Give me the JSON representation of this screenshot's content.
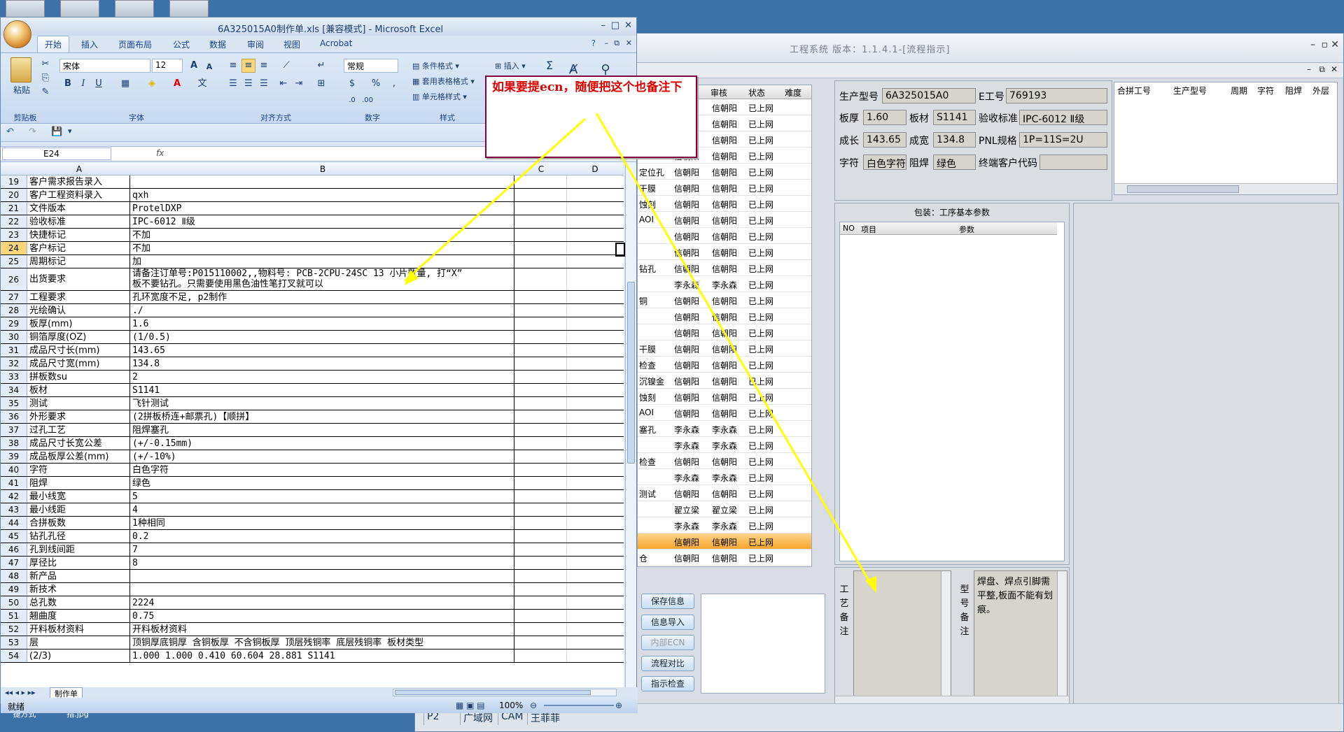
{
  "desktop": {
    "bottom_icons": [
      "FastMsg - 快捷方式",
      "正常金手指.jpg"
    ]
  },
  "app": {
    "title": "工程系统 版本：1.1.4.1-[流程指示]",
    "grid": {
      "headers": [
        "审核",
        "状态",
        "难度"
      ],
      "rows": [
        {
          "a": "",
          "b": "信朝阳",
          "c": "信朝阳",
          "s": "已上网"
        },
        {
          "a": "",
          "b": "信朝阳",
          "c": "信朝阳",
          "s": "已上网"
        },
        {
          "a": "",
          "b": "信朝阳",
          "c": "信朝阳",
          "s": "已上网"
        },
        {
          "a": "",
          "b": "信朝阳",
          "c": "信朝阳",
          "s": "已上网"
        },
        {
          "a": "定位孔",
          "b": "信朝阳",
          "c": "信朝阳",
          "s": "已上网"
        },
        {
          "a": "干膜",
          "b": "信朝阳",
          "c": "信朝阳",
          "s": "已上网"
        },
        {
          "a": "蚀刻",
          "b": "信朝阳",
          "c": "信朝阳",
          "s": "已上网"
        },
        {
          "a": "AOI",
          "b": "信朝阳",
          "c": "信朝阳",
          "s": "已上网"
        },
        {
          "a": "",
          "b": "信朝阳",
          "c": "信朝阳",
          "s": "已上网"
        },
        {
          "a": "",
          "b": "信朝阳",
          "c": "信朝阳",
          "s": "已上网"
        },
        {
          "a": "钻孔",
          "b": "信朝阳",
          "c": "信朝阳",
          "s": "已上网"
        },
        {
          "a": "",
          "b": "李永森",
          "c": "李永森",
          "s": "已上网"
        },
        {
          "a": "铜",
          "b": "信朝阳",
          "c": "信朝阳",
          "s": "已上网"
        },
        {
          "a": "",
          "b": "信朝阳",
          "c": "信朝阳",
          "s": "已上网"
        },
        {
          "a": "",
          "b": "信朝阳",
          "c": "信朝阳",
          "s": "已上网"
        },
        {
          "a": "干膜",
          "b": "信朝阳",
          "c": "信朝阳",
          "s": "已上网"
        },
        {
          "a": "检查",
          "b": "信朝阳",
          "c": "信朝阳",
          "s": "已上网"
        },
        {
          "a": "沉镍金",
          "b": "信朝阳",
          "c": "信朝阳",
          "s": "已上网"
        },
        {
          "a": "蚀刻",
          "b": "信朝阳",
          "c": "信朝阳",
          "s": "已上网"
        },
        {
          "a": "AOI",
          "b": "信朝阳",
          "c": "信朝阳",
          "s": "已上网"
        },
        {
          "a": "塞孔",
          "b": "李永森",
          "c": "李永森",
          "s": "已上网"
        },
        {
          "a": "",
          "b": "李永森",
          "c": "李永森",
          "s": "已上网"
        },
        {
          "a": "检查",
          "b": "信朝阳",
          "c": "信朝阳",
          "s": "已上网"
        },
        {
          "a": "",
          "b": "李永森",
          "c": "李永森",
          "s": "已上网"
        },
        {
          "a": "测试",
          "b": "信朝阳",
          "c": "信朝阳",
          "s": "已上网"
        },
        {
          "a": "",
          "b": "翟立梁",
          "c": "翟立梁",
          "s": "已上网"
        },
        {
          "a": "",
          "b": "李永森",
          "c": "李永森",
          "s": "已上网"
        },
        {
          "a": "",
          "b": "信朝阳",
          "c": "信朝阳",
          "s": "已上网",
          "selected": true
        },
        {
          "a": "仓",
          "b": "信朝阳",
          "c": "信朝阳",
          "s": "已上网"
        }
      ]
    },
    "buttons": [
      "保存信息",
      "信息导入",
      "内部ECN",
      "流程对比",
      "指示检查"
    ],
    "info": {
      "prod_model_label": "生产型号",
      "prod_model": "6A325015A0",
      "eno_label": "E工号",
      "eno": "769193",
      "thick_label": "板厚",
      "thick": "1.60",
      "mat_label": "板材",
      "mat": "S1141",
      "std_label": "验收标准",
      "std": "IPC-6012 Ⅱ级",
      "len_label": "成长",
      "len": "143.65",
      "wid_label": "成宽",
      "wid": "134.8",
      "pnl_label": "PNL规格",
      "pnl": "1P=11S=2U",
      "char_label": "字符",
      "char": "白色字符",
      "mask_label": "阻焊",
      "mask": "绿色",
      "cust_label": "终端客户代码",
      "cust": ""
    },
    "rtable_headers": [
      "合拼工号",
      "生产型号",
      "周期",
      "字符",
      "阻焊",
      "外层"
    ],
    "param": {
      "title": "包装：工序基本参数",
      "headers": [
        "NO",
        "项目",
        "参数"
      ]
    },
    "remarks": {
      "process_label": "工艺备注",
      "model_label": "型号备注",
      "model_note": "焊盘、焊点引脚需平整,板面不能有划痕。"
    },
    "status_tabs": [
      "P2",
      "广域网",
      "CAM",
      "王菲菲"
    ]
  },
  "excel": {
    "title": "6A325015A0制作单.xls  [兼容模式] - Microsoft Excel",
    "tabs": [
      "开始",
      "插入",
      "页面布局",
      "公式",
      "数据",
      "审阅",
      "视图",
      "Acrobat"
    ],
    "font_name": "宋体",
    "font_size": "12",
    "number_format": "常规",
    "groups": [
      "剪贴板",
      "字体",
      "对齐方式",
      "数字",
      "样式"
    ],
    "paste_label": "粘贴",
    "styles": [
      "条件格式",
      "套用表格格式",
      "单元格样式"
    ],
    "insert_label": "插入",
    "name_box": "E24",
    "fx": "fx",
    "columns": [
      "A",
      "B",
      "C",
      "D"
    ],
    "rows": [
      {
        "n": "19",
        "a": "客户需求报告录入",
        "b": ""
      },
      {
        "n": "20",
        "a": "客户工程资料录入",
        "b": "qxh"
      },
      {
        "n": "21",
        "a": "文件版本",
        "b": "ProtelDXP"
      },
      {
        "n": "22",
        "a": "验收标准",
        "b": "IPC-6012 Ⅱ级"
      },
      {
        "n": "23",
        "a": "快捷标记",
        "b": "不加"
      },
      {
        "n": "24",
        "a": "客户标记",
        "b": "不加"
      },
      {
        "n": "25",
        "a": "周期标记",
        "b": "加"
      },
      {
        "n": "26",
        "a": "出货要求",
        "b": "请备注订单号:P015110002,,物料号: PCB-2CPU-24SC 13  小片数量, 打“X”",
        "b2": "板不要钻孔。只需要使用黑色油性笔打叉就可以"
      },
      {
        "n": "27",
        "a": "工程要求",
        "b": "孔环宽度不足, p2制作"
      },
      {
        "n": "28",
        "a": "光绘确认",
        "b": "./"
      },
      {
        "n": "29",
        "a": "板厚(mm)",
        "b": "1.6"
      },
      {
        "n": "30",
        "a": "铜箔厚度(OZ)",
        "b": " (1/0.5)"
      },
      {
        "n": "31",
        "a": "成品尺寸长(mm)",
        "b": "143.65"
      },
      {
        "n": "32",
        "a": "成品尺寸宽(mm)",
        "b": "134.8"
      },
      {
        "n": "33",
        "a": "拼板数su",
        "b": "2"
      },
      {
        "n": "34",
        "a": "板材",
        "b": "S1141"
      },
      {
        "n": "35",
        "a": "测试",
        "b": "飞针测试"
      },
      {
        "n": "36",
        "a": "外形要求",
        "b": "(2拼板桥连+邮票孔)【顺拼】"
      },
      {
        "n": "37",
        "a": "过孔工艺",
        "b": "阻焊塞孔"
      },
      {
        "n": "38",
        "a": "成品尺寸长宽公差",
        "b": "(+/-0.15mm)"
      },
      {
        "n": "39",
        "a": "成品板厚公差(mm)",
        "b": "(+/-10%)"
      },
      {
        "n": "40",
        "a": "字符",
        "b": "白色字符"
      },
      {
        "n": "41",
        "a": "阻焊",
        "b": "绿色"
      },
      {
        "n": "42",
        "a": "最小线宽",
        "b": "5"
      },
      {
        "n": "43",
        "a": "最小线距",
        "b": "4"
      },
      {
        "n": "44",
        "a": "合拼板数",
        "b": "1种相同"
      },
      {
        "n": "45",
        "a": "钻孔孔径",
        "b": "0.2"
      },
      {
        "n": "46",
        "a": "孔到线间距",
        "b": "7"
      },
      {
        "n": "47",
        "a": "厚径比",
        "b": "8"
      },
      {
        "n": "48",
        "a": "新产品",
        "b": ""
      },
      {
        "n": "49",
        "a": "新技术",
        "b": ""
      },
      {
        "n": "50",
        "a": "总孔数",
        "b": "2224"
      },
      {
        "n": "51",
        "a": "翘曲度",
        "b": "0.75"
      },
      {
        "n": "52",
        "a": "开料板材资料",
        "b": "开料板材资料"
      },
      {
        "n": "53",
        "a": "层",
        "b": "顶铜厚底铜厚 含铜板厚 不含铜板厚 顶层残铜率 底层残铜率 板材类型"
      },
      {
        "n": "54",
        "a": "(2/3)",
        "b": "1.000  1.000          0.410        60.604    28.881      S1141"
      }
    ],
    "sheet_tab": "制作单",
    "status": "就绪",
    "zoom": "100%"
  },
  "callout": {
    "text": "如果要提ecn，随便把这个也备注下"
  },
  "colors": {
    "annotation": "#ffff00",
    "callout_text": "#e00000",
    "selected_row": "#f5a52c"
  }
}
